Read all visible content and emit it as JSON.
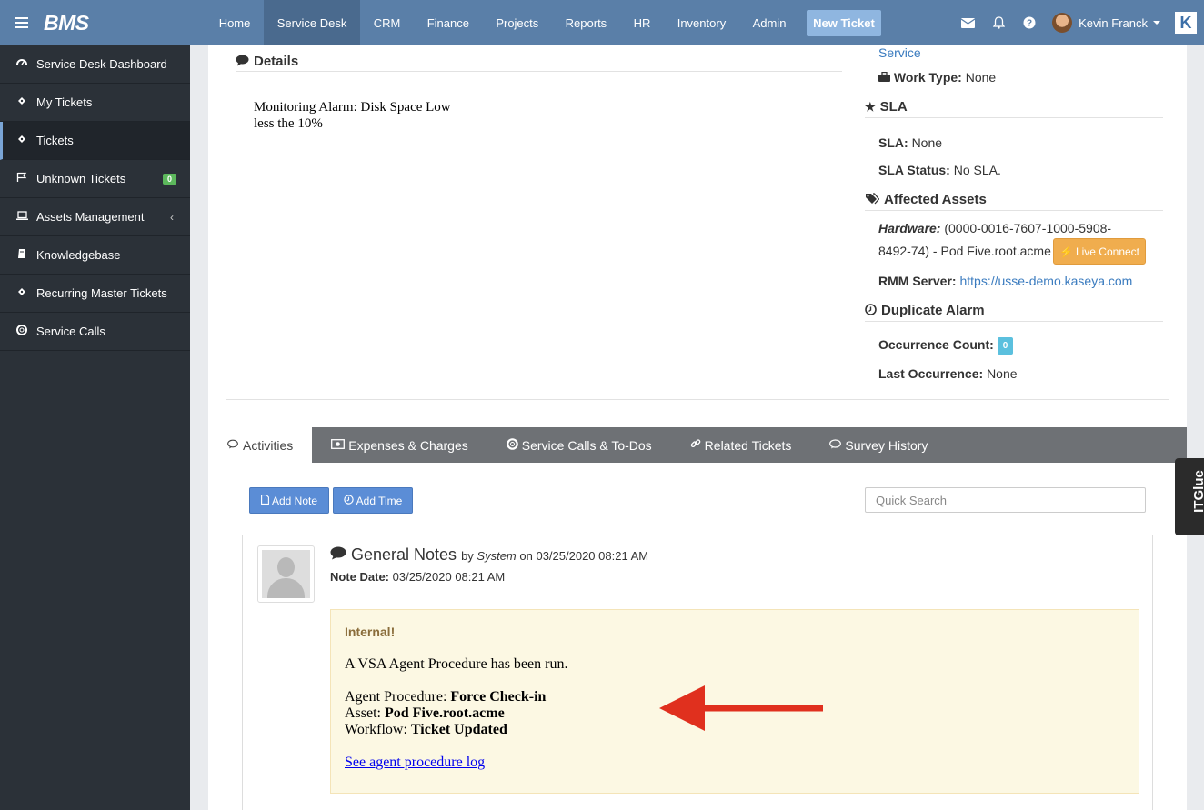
{
  "topbar": {
    "logo": "BMS",
    "nav": [
      "Home",
      "Service Desk",
      "CRM",
      "Finance",
      "Projects",
      "Reports",
      "HR",
      "Inventory",
      "Admin"
    ],
    "new_ticket": "New Ticket",
    "user_name": "Kevin Franck"
  },
  "sidebar": {
    "items": [
      {
        "label": "Service Desk Dashboard",
        "icon": "dashboard-icon"
      },
      {
        "label": "My Tickets",
        "icon": "ticket-icon"
      },
      {
        "label": "Tickets",
        "icon": "ticket-icon"
      },
      {
        "label": "Unknown Tickets",
        "icon": "flag-icon",
        "badge": "0"
      },
      {
        "label": "Assets Management",
        "icon": "laptop-icon"
      },
      {
        "label": "Knowledgebase",
        "icon": "book-icon"
      },
      {
        "label": "Recurring Master Tickets",
        "icon": "ticket-icon"
      },
      {
        "label": "Service Calls",
        "icon": "lifebuoy-icon"
      }
    ]
  },
  "details": {
    "heading": "Details",
    "text_line1": "Monitoring Alarm: Disk Space Low",
    "text_line2": "less the 10%"
  },
  "right_panel": {
    "service_link": "Service",
    "work_type_label": "Work Type:",
    "work_type_value": "None",
    "sla_heading": "SLA",
    "sla_label": "SLA:",
    "sla_value": "None",
    "sla_status_label": "SLA Status:",
    "sla_status_value": "No SLA.",
    "affected_heading": "Affected Assets",
    "hardware_label": "Hardware:",
    "hardware_value_1": "(0000-0016-7607-1000-5908-",
    "hardware_value_2": "8492-74) - Pod Five.root.acme",
    "live_connect": "Live Connect",
    "rmm_label": "RMM Server:",
    "rmm_value": "https://usse-demo.kaseya.com",
    "dup_heading": "Duplicate Alarm",
    "occ_label": "Occurrence Count:",
    "occ_value": "0",
    "last_occ_label": "Last Occurrence:",
    "last_occ_value": "None"
  },
  "tabs": [
    "Activities",
    "Expenses & Charges",
    "Service Calls & To-Dos",
    "Related Tickets",
    "Survey History"
  ],
  "actions": {
    "add_note": "Add Note",
    "add_time": "Add Time",
    "search_placeholder": "Quick Search"
  },
  "note": {
    "title": "General Notes",
    "by": "by",
    "author": "System",
    "on": "on 03/25/2020 08:21 AM",
    "date_label": "Note Date:",
    "date_value": "03/25/2020 08:21 AM",
    "internal": "Internal!",
    "line1": "A VSA Agent Procedure has been run.",
    "proc_label": "Agent Procedure:",
    "proc_value": "Force Check-in",
    "asset_label": "Asset:",
    "asset_value": "Pod Five.root.acme",
    "workflow_label": "Workflow:",
    "workflow_value": "Ticket Updated",
    "log_link": "See agent procedure log"
  },
  "itglue": "ITGlue",
  "colors": {
    "topbar": "#5a7fa8",
    "sidebar": "#2b3138",
    "accent": "#5b8dd6",
    "arrow": "#e0301e"
  }
}
